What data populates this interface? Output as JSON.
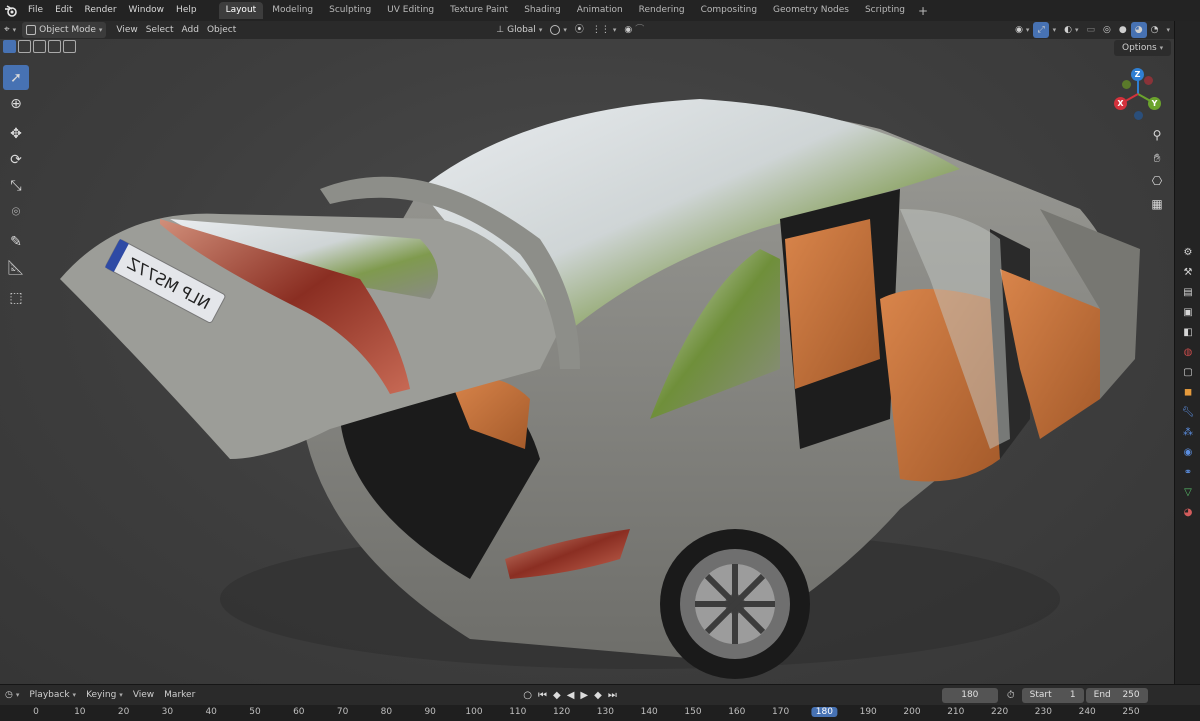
{
  "menu": [
    "File",
    "Edit",
    "Render",
    "Window",
    "Help"
  ],
  "workspaces": [
    "Layout",
    "Modeling",
    "Sculpting",
    "UV Editing",
    "Texture Paint",
    "Shading",
    "Animation",
    "Rendering",
    "Compositing",
    "Geometry Nodes",
    "Scripting"
  ],
  "active_workspace": "Layout",
  "header": {
    "mode": "Object Mode",
    "view": "View",
    "select": "Select",
    "add": "Add",
    "object": "Object",
    "orientation": "Global",
    "options": "Options"
  },
  "gizmo": {
    "z": "Z",
    "y": "Y",
    "x": "X"
  },
  "timeline": {
    "playback": "Playback",
    "keying": "Keying",
    "view": "View",
    "marker": "Marker",
    "current_frame": "180",
    "start_label": "Start",
    "start": "1",
    "end_label": "End",
    "end": "250"
  },
  "ruler": [
    "0",
    "10",
    "20",
    "30",
    "40",
    "50",
    "60",
    "70",
    "80",
    "90",
    "100",
    "110",
    "120",
    "130",
    "140",
    "150",
    "160",
    "170",
    "180",
    "190",
    "200",
    "210",
    "220",
    "230",
    "240",
    "250"
  ],
  "ruler_current": "180",
  "license_plate": "NLP MS77Z",
  "colors": {
    "accent": "#4772b3",
    "leather": "#c8703a",
    "body": "#8c8c86"
  }
}
